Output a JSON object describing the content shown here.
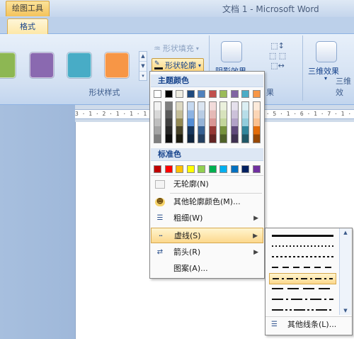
{
  "titlebar": {
    "context_tab": "绘图工具",
    "window_title": "文档 1 - Microsoft Word"
  },
  "tabs": {
    "active": "格式"
  },
  "ribbon": {
    "shape_styles_label": "形状样式",
    "style_swatches": [
      "#8db753",
      "#8a69b0",
      "#48acc6",
      "#f79646"
    ],
    "shape_fill": "形状填充",
    "shape_outline": "形状轮廓",
    "shadow_effects": "阴影效果",
    "three_d_effects": "三维效果",
    "three_d_label": "三维效",
    "shadow_group_label_partial": "果"
  },
  "ruler": {
    "text": "3 · 1 · 2 · 1 · 1 · 1 ·     · 1 · 1 · 2 · 1 · 3 · 1 · 4 · 1 · 5 · 1 · 6 · 1 · 7 · 1 · 8"
  },
  "outline_menu": {
    "theme_colors_label": "主题颜色",
    "theme_colors": [
      "#ffffff",
      "#000000",
      "#eeece1",
      "#1f497d",
      "#4f81bd",
      "#c0504d",
      "#9bbb59",
      "#8064a2",
      "#4bacc6",
      "#f79646"
    ],
    "shade_columns": [
      [
        "#f2f2f2",
        "#d8d8d8",
        "#bfbfbf",
        "#a5a5a5",
        "#7f7f7f"
      ],
      [
        "#7f7f7f",
        "#595959",
        "#3f3f3f",
        "#262626",
        "#0c0c0c"
      ],
      [
        "#ddd9c3",
        "#c4bd97",
        "#938953",
        "#494429",
        "#1d1b10"
      ],
      [
        "#c6d9f0",
        "#8db3e2",
        "#548dd4",
        "#17365d",
        "#0f243e"
      ],
      [
        "#dbe5f1",
        "#b8cce4",
        "#95b3d7",
        "#366092",
        "#244061"
      ],
      [
        "#f2dcdb",
        "#e5b9b7",
        "#d99694",
        "#953734",
        "#632423"
      ],
      [
        "#ebf1dd",
        "#d7e3bc",
        "#c3d69b",
        "#76923c",
        "#4f6128"
      ],
      [
        "#e5e0ec",
        "#ccc1d9",
        "#b2a2c7",
        "#5f497a",
        "#3f3151"
      ],
      [
        "#dbeef3",
        "#b7dde8",
        "#92cddc",
        "#31859b",
        "#205867"
      ],
      [
        "#fdeada",
        "#fbd5b5",
        "#fac08f",
        "#e36c09",
        "#974806"
      ]
    ],
    "standard_colors_label": "标准色",
    "standard_colors": [
      "#c00000",
      "#ff0000",
      "#ffc000",
      "#ffff00",
      "#92d050",
      "#00b050",
      "#00b0f0",
      "#0070c0",
      "#002060",
      "#7030a0"
    ],
    "no_outline": "无轮廓(N)",
    "more_colors": "其他轮廓颜色(M)...",
    "weight": "粗细(W)",
    "dashes": "虚线(S)",
    "arrows": "箭头(R)",
    "pattern": "图案(A)..."
  },
  "dash_submenu": {
    "styles": [
      "solid",
      "round-dot",
      "square-dot",
      "dash",
      "dash-dot",
      "long-dash",
      "long-dash-dot",
      "long-dash-dot-dot"
    ],
    "selected": "dash-dot",
    "more_lines": "其他线条(L)..."
  }
}
